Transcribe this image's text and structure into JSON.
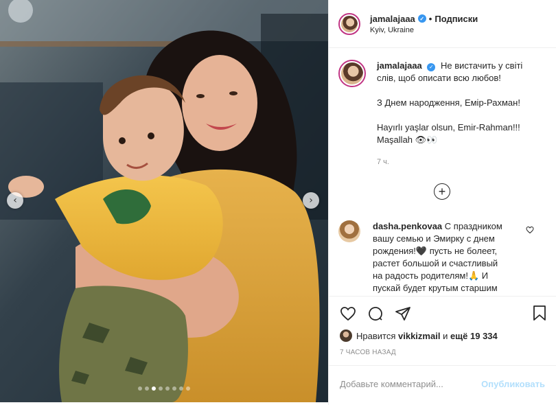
{
  "post": {
    "username": "jamalajaaa",
    "separator": "•",
    "follow_label": "Подписки",
    "location": "Kyiv, Ukraine"
  },
  "caption": {
    "username": "jamalajaaa",
    "line1": "Не вистачить у світі слів, щоб описати всю любов!",
    "line2": "З Днем народження, Емір-Рахман!",
    "line3": "Hayırlı yaşlar olsun, Emir-Rahman!!! Maşallah 👁👀",
    "time": "7 ч."
  },
  "load_more": "+",
  "comment": {
    "username": "dasha.penkovaa",
    "text": "С праздником вашу семью и Эмирку с днем рождения!🖤 пусть не болеет, растет большой и счастливый на радость родителям!🙏 И пускай будет крутым старшим"
  },
  "likes": {
    "prefix": "Нравится",
    "user": "vikkizmail",
    "middle": "и",
    "count": "ещё 19 334"
  },
  "timeago": "7 ЧАСОВ НАЗАД",
  "add_comment": {
    "placeholder": "Добавьте комментарий...",
    "publish": "Опубликовать"
  },
  "carousel": {
    "prev": "‹",
    "next": "›",
    "slides": 8,
    "active_index": 2
  },
  "icons": {
    "like": "heart-icon",
    "comment": "comment-icon",
    "share": "share-icon",
    "save": "bookmark-icon"
  },
  "colors": {
    "accent": "#3897f0",
    "story_ring": "#c13584",
    "publish_disabled": "#b2dffc"
  }
}
